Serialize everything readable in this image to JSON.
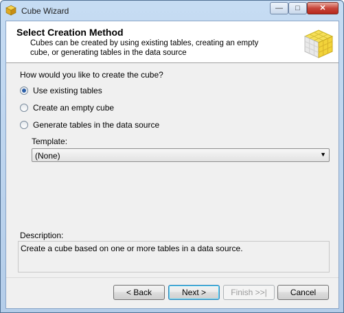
{
  "window": {
    "title": "Cube Wizard"
  },
  "header": {
    "title": "Select Creation Method",
    "description": "Cubes can be created by using existing tables, creating an empty cube, or generating tables in the data source"
  },
  "main": {
    "question": "How would you like to create the cube?",
    "options": [
      {
        "label": "Use existing tables",
        "checked": true
      },
      {
        "label": "Create an empty cube",
        "checked": false
      },
      {
        "label": "Generate tables in the data source",
        "checked": false
      }
    ],
    "template_label": "Template:",
    "template_value": "(None)",
    "description_label": "Description:",
    "description_text": "Create a cube based on one or more tables in a data source."
  },
  "buttons": {
    "back": "< Back",
    "next": "Next >",
    "finish": "Finish >>|",
    "cancel": "Cancel"
  },
  "colors": {
    "accent": "#2c5fa8",
    "close": "#c7453a"
  },
  "icons": [
    "cube-app-icon",
    "minimize-icon",
    "maximize-icon",
    "close-icon",
    "cube-header-icon",
    "dropdown-arrow-icon"
  ]
}
